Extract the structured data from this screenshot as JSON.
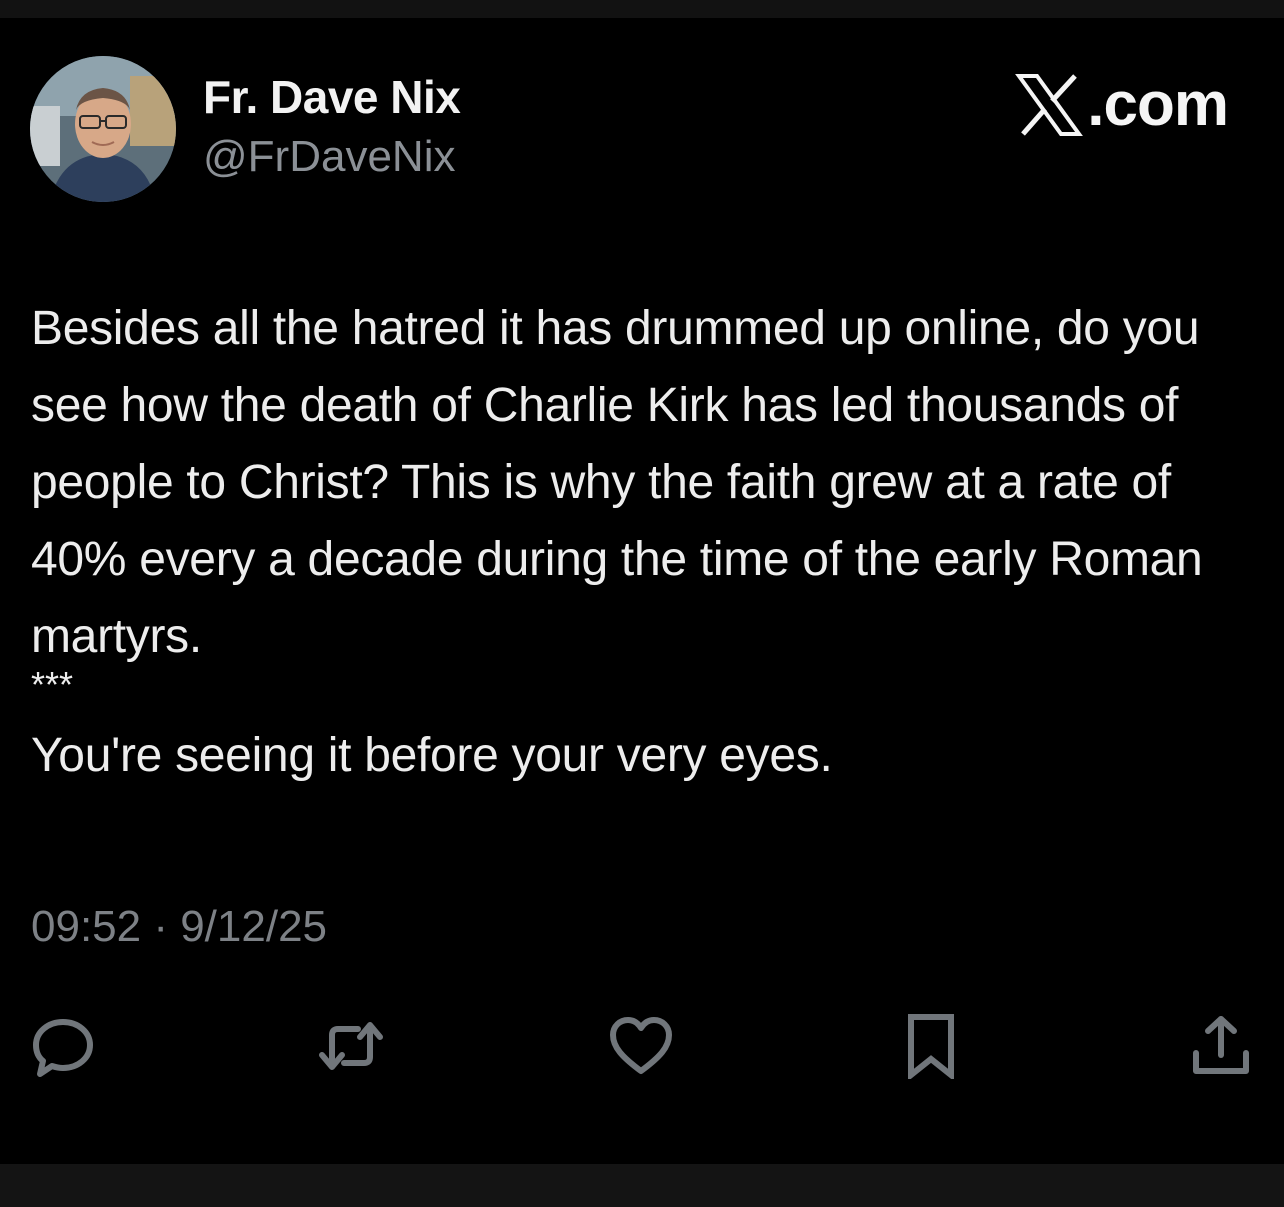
{
  "author": {
    "display_name": "Fr. Dave Nix",
    "handle": "@FrDaveNix"
  },
  "brand": {
    "text": ".com",
    "icon": "x-logo-icon"
  },
  "post": {
    "paragraph_1": "Besides all the hatred it has drummed up online, do you see how the death of Charlie Kirk has led thousands of people to Christ? This is why the faith grew at a rate of 40% every a decade during the time of the early Roman martyrs.",
    "separator": "***",
    "paragraph_2": "You're seeing it before your very eyes."
  },
  "timestamp": "09:52 · 9/12/25",
  "actions": [
    {
      "name": "reply",
      "icon": "reply-icon"
    },
    {
      "name": "repost",
      "icon": "repost-icon"
    },
    {
      "name": "like",
      "icon": "heart-icon"
    },
    {
      "name": "bookmark",
      "icon": "bookmark-icon"
    },
    {
      "name": "share",
      "icon": "share-icon"
    }
  ],
  "colors": {
    "background": "#000000",
    "text": "#e7e9ea",
    "secondary_text": "#8b9096",
    "icon": "#71767b"
  }
}
